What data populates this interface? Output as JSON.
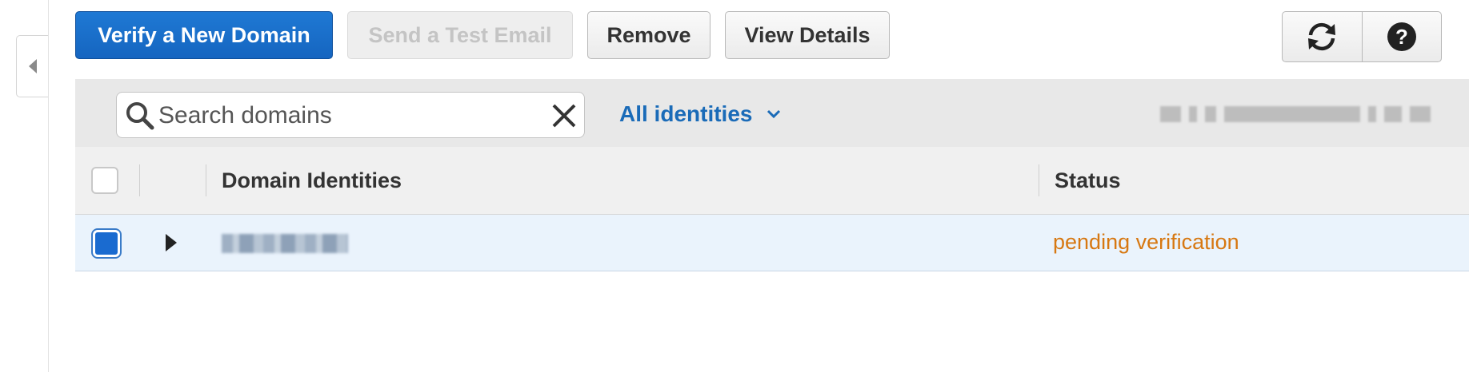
{
  "toolbar": {
    "verify_domain_label": "Verify a New Domain",
    "send_test_email_label": "Send a Test Email",
    "remove_label": "Remove",
    "view_details_label": "View Details",
    "refresh_icon": "refresh-icon",
    "help_icon": "help-icon"
  },
  "filter": {
    "search_placeholder": "Search domains",
    "search_value": "",
    "identities_label": "All identities",
    "identities_icon": "chevron-down-icon"
  },
  "table": {
    "columns": [
      "Domain Identities",
      "Status"
    ],
    "rows": [
      {
        "checked": true,
        "domain": "",
        "status": "pending verification"
      }
    ]
  },
  "colors": {
    "primary_button": "#1565c0",
    "link_blue": "#1a6bb8",
    "status_pending": "#d77812",
    "selected_row": "#eaf3fc"
  }
}
